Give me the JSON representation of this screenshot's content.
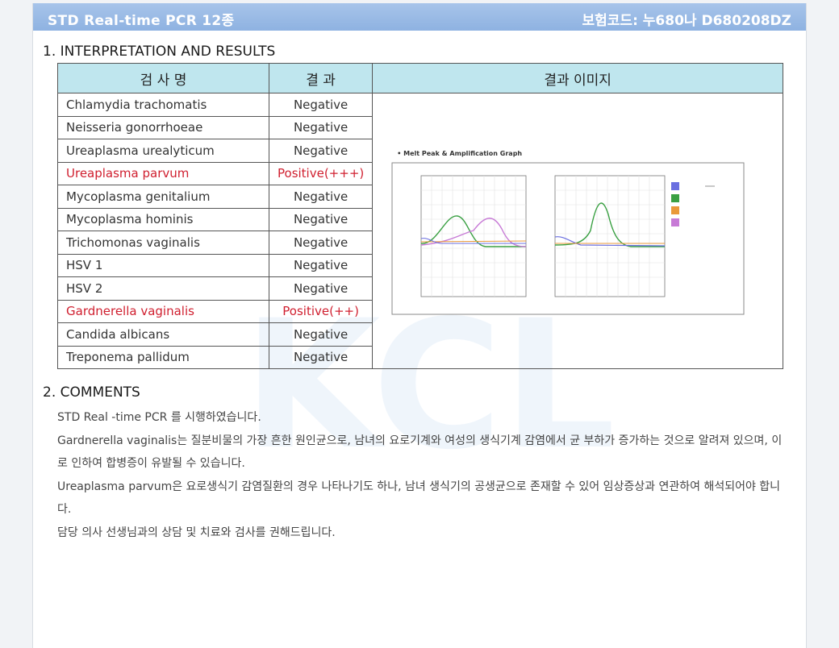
{
  "header": {
    "title": "STD Real-time PCR 12종",
    "code": "보험코드: 누680나 D680208DZ"
  },
  "section1": {
    "title": "1. INTERPRETATION AND RESULTS"
  },
  "table": {
    "headers": [
      "검 사 명",
      "결 과",
      "결과 이미지"
    ],
    "rows": [
      {
        "name": "Chlamydia trachomatis",
        "result": "Negative"
      },
      {
        "name": "Neisseria gonorrhoeae",
        "result": "Negative"
      },
      {
        "name": "Ureaplasma urealyticum",
        "result": "Negative"
      },
      {
        "name": "Ureaplasma parvum",
        "result": "Positive(+++)"
      },
      {
        "name": "Mycoplasma genitalium",
        "result": "Negative"
      },
      {
        "name": "Mycoplasma hominis",
        "result": "Negative"
      },
      {
        "name": "Trichomonas vaginalis",
        "result": "Negative"
      },
      {
        "name": "HSV 1",
        "result": "Negative"
      },
      {
        "name": "HSV 2",
        "result": "Negative"
      },
      {
        "name": "Gardnerella vaginalis",
        "result": "Positive(++)"
      },
      {
        "name": "Candida albicans",
        "result": "Negative"
      },
      {
        "name": "Treponema pallidum",
        "result": "Negative"
      }
    ]
  },
  "graph": {
    "title": "• Melt Peak & Amplification Graph"
  },
  "section2": {
    "title": "2. COMMENTS"
  },
  "comments": [
    "STD Real -time PCR 를 시행하였습니다.",
    "Gardnerella vaginalis는 질분비물의 가장 흔한 원인균으로, 남녀의 요로기계와 여성의 생식기계 감염에서 균 부하가 증가하는 것으로 알려져 있으며, 이로 인하여 합병증이 유발될 수 있습니다.",
    "Ureaplasma parvum은 요로생식기 감염질환의 경우 나타나기도 하나, 남녀 생식기의 공생균으로 존재할 수 있어 임상증상과 연관하여 해석되어야 합니다.",
    "담당 의사 선생님과의 상담 및 치료와 검사를 권해드립니다."
  ],
  "colors": {
    "header_bg": "#8eb2e1",
    "table_header_bg": "#bfe6ee",
    "positive": "#d01f2f",
    "curve_green": "#3aa043",
    "curve_purple": "#c77ad6",
    "curve_blue": "#6a6fe0",
    "curve_orange": "#e9993a"
  }
}
